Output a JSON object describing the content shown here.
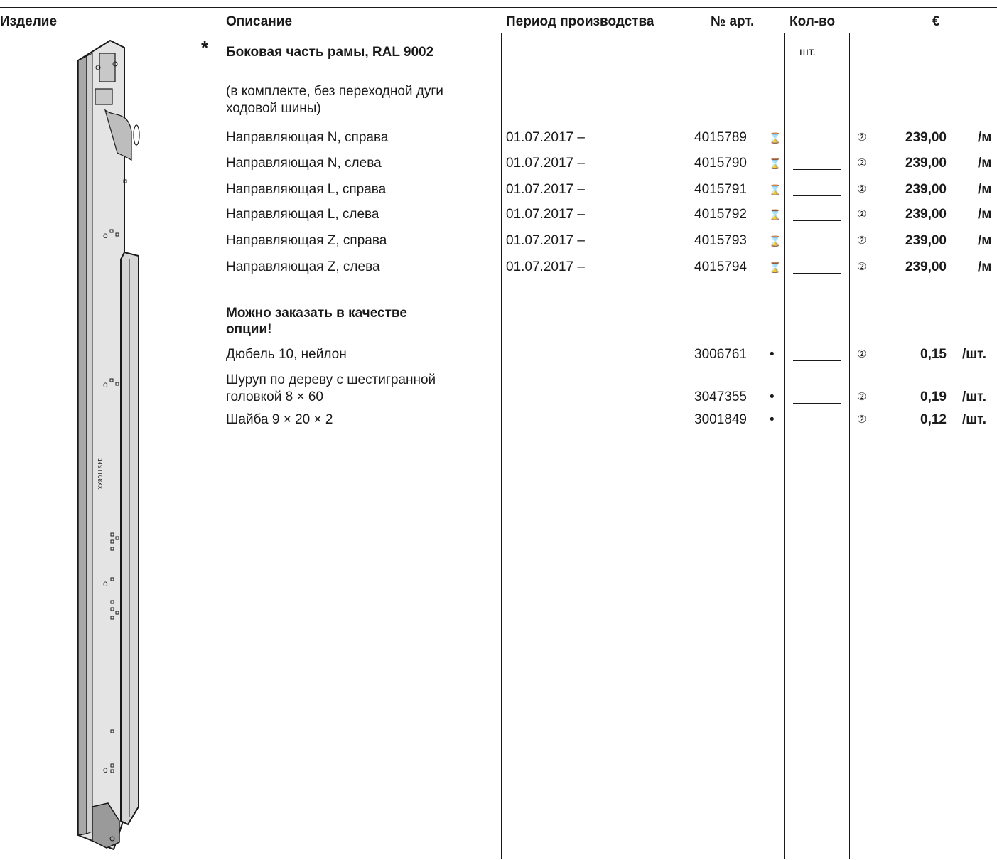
{
  "headers": {
    "product": "Изделие",
    "description": "Описание",
    "period": "Период производства",
    "article": "№ арт.",
    "qty": "Кол-во",
    "price": "€"
  },
  "section": {
    "star": "*",
    "title": "Боковая часть рамы, RAL 9002",
    "qty_unit": "шт.",
    "note": [
      "(в комплекте, без переходной дуги",
      "ходовой шины)"
    ]
  },
  "rows": [
    {
      "desc": "Направляющая N, справа",
      "period": "01.07.2017 –",
      "article": "4015789",
      "flag": "⌛",
      "price_group": "②",
      "price": "239,00",
      "unit": "/м"
    },
    {
      "desc": "Направляющая N, слева",
      "period": "01.07.2017 –",
      "article": "4015790",
      "flag": "⌛",
      "price_group": "②",
      "price": "239,00",
      "unit": "/м"
    },
    {
      "desc": "Направляющая L, справа",
      "period": "01.07.2017 –",
      "article": "4015791",
      "flag": "⌛",
      "price_group": "②",
      "price": "239,00",
      "unit": "/м"
    },
    {
      "desc": "Направляющая L, слева",
      "period": "01.07.2017 –",
      "article": "4015792",
      "flag": "⌛",
      "price_group": "②",
      "price": "239,00",
      "unit": "/м"
    },
    {
      "desc": "Направляющая Z, справа",
      "period": "01.07.2017 –",
      "article": "4015793",
      "flag": "⌛",
      "price_group": "②",
      "price": "239,00",
      "unit": "/м"
    },
    {
      "desc": "Направляющая Z, слева",
      "period": "01.07.2017 –",
      "article": "4015794",
      "flag": "⌛",
      "price_group": "②",
      "price": "239,00",
      "unit": "/м"
    }
  ],
  "options": {
    "title": [
      "Можно заказать в качестве",
      "опции!"
    ],
    "items": [
      {
        "desc": [
          "Дюбель 10, нейлон"
        ],
        "article": "3006761",
        "flag": "•",
        "price_group": "②",
        "price": "0,15",
        "unit": "/шт."
      },
      {
        "desc": [
          "Шуруп по дереву с шестигранной",
          "головкой 8 × 60"
        ],
        "article": "3047355",
        "flag": "•",
        "price_group": "②",
        "price": "0,19",
        "unit": "/шт."
      },
      {
        "desc": [
          "Шайба 9 × 20 × 2"
        ],
        "article": "3001849",
        "flag": "•",
        "price_group": "②",
        "price": "0,12",
        "unit": "/шт."
      }
    ]
  },
  "illustration": {
    "label": "14STT08XX",
    "colors": {
      "frame": "#d6d6d6",
      "frame_dark": "#a8a8a8",
      "outline": "#1a1a1a"
    }
  }
}
